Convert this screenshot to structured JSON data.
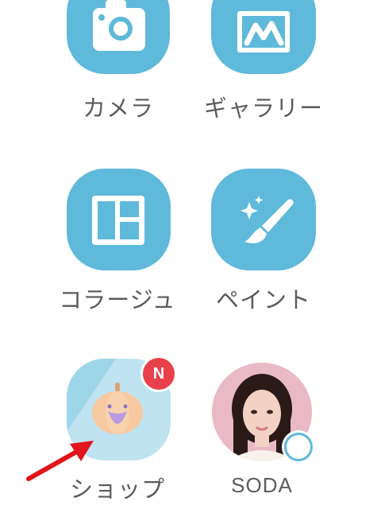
{
  "apps": {
    "camera": {
      "label": "カメラ"
    },
    "gallery": {
      "label": "ギャラリー"
    },
    "collage": {
      "label": "コラージュ"
    },
    "paint": {
      "label": "ペイント"
    },
    "shop": {
      "label": "ショップ",
      "badge": "N"
    },
    "soda": {
      "label": "SODA"
    }
  },
  "colors": {
    "tile": "#5fb9db",
    "shop_tile": "#bfe3f0",
    "badge": "#e8414c",
    "label_text": "#5b5b5b",
    "arrow": "#e2141b"
  },
  "icons": {
    "camera": "camera-icon",
    "gallery": "mountain-icon",
    "collage": "layout-grid-icon",
    "paint": "paintbrush-sparkle-icon",
    "shop": "pumpkin-icon",
    "soda": "avatar-portrait-icon"
  }
}
